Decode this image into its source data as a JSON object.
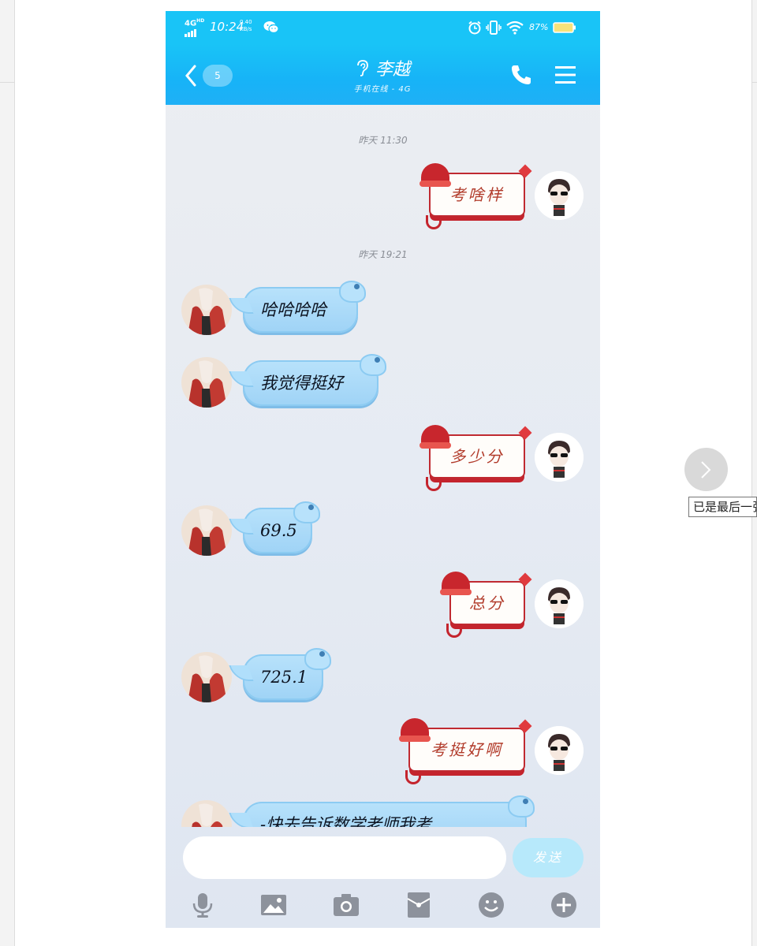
{
  "statusbar": {
    "network": "4G",
    "network_badge": "HD",
    "time": "10:24",
    "speed_value": "0.40",
    "speed_unit": "KB/s",
    "battery_percent": "87%"
  },
  "header": {
    "back_count": "5",
    "contact_name": "李越",
    "contact_status": "手机在线 - 4G"
  },
  "messages": [
    {
      "type": "time",
      "text": "昨天 11:30"
    },
    {
      "type": "out",
      "text": "考啥样"
    },
    {
      "type": "time",
      "text": "昨天 19:21"
    },
    {
      "type": "in",
      "text": "哈哈哈哈"
    },
    {
      "type": "in",
      "text": "我觉得挺好"
    },
    {
      "type": "out",
      "text": "多少分"
    },
    {
      "type": "in",
      "text": "69.5"
    },
    {
      "type": "out",
      "text": "总分"
    },
    {
      "type": "in",
      "text": "725.1"
    },
    {
      "type": "out",
      "text": "考挺好啊"
    },
    {
      "type": "in",
      "text": "-快去告诉数学老师我考"
    }
  ],
  "input": {
    "value": "",
    "send_label": "发送"
  },
  "toolbar": [
    "microphone-icon",
    "image-icon",
    "camera-icon",
    "red-packet-icon",
    "emoji-icon",
    "plus-icon"
  ],
  "viewer": {
    "tooltip": "已是最后一张"
  },
  "colors": {
    "header_blue": "#19c4f7",
    "bubble_in": "#a9d9f8",
    "bubble_out_border": "#c02a31",
    "send_button": "#b7e9fb"
  }
}
